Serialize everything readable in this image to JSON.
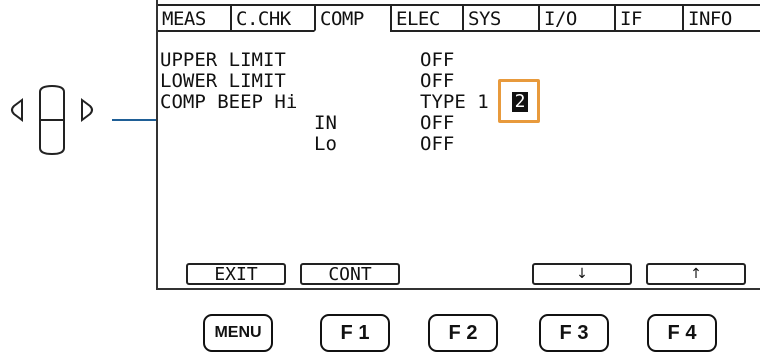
{
  "tabs": [
    "MEAS",
    "C.CHK",
    "COMP",
    "ELEC",
    "SYS",
    "I/O",
    "IF",
    "INFO"
  ],
  "settings": [
    {
      "label": "UPPER LIMIT",
      "value": "OFF"
    },
    {
      "label": "LOWER LIMIT",
      "value": "OFF"
    },
    {
      "label": "COMP BEEP Hi",
      "value": "TYPE 1"
    },
    {
      "label": "IN",
      "value": "OFF"
    },
    {
      "label": "Lo",
      "value": "OFF"
    }
  ],
  "cursor_value": "2",
  "function_keys": {
    "f1": "EXIT",
    "f2": "CONT",
    "f3": "↓",
    "f4": "↑"
  },
  "hardware_keys": {
    "menu": "MENU",
    "f1": "F 1",
    "f2": "F 2",
    "f3": "F 3",
    "f4": "F 4"
  },
  "colors": {
    "highlight": "#e89a3c",
    "leader": "#1f5f96"
  }
}
